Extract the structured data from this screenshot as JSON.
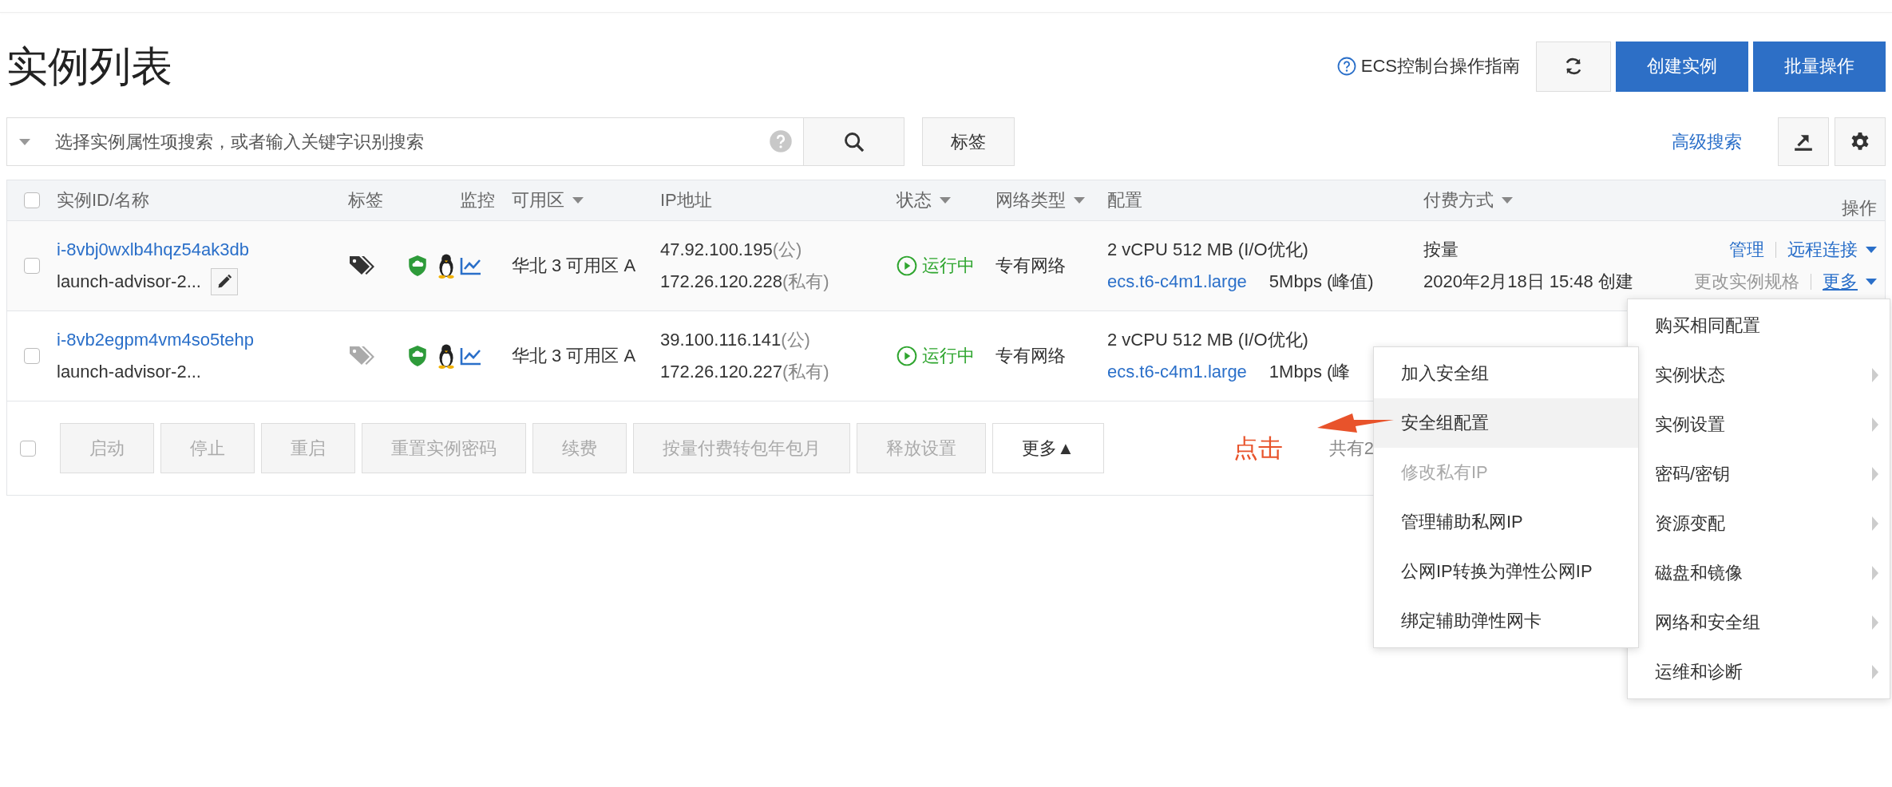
{
  "page_title": "实例列表",
  "header_actions": {
    "guide_link": "ECS控制台操作指南",
    "buttons": [
      {
        "label": "创建实例"
      },
      {
        "label": "批量操作"
      }
    ]
  },
  "search": {
    "placeholder": "选择实例属性项搜索，或者输入关键字识别搜索"
  },
  "tag_button": "标签",
  "advanced_search": "高级搜索",
  "table": {
    "header_checked": false,
    "columns": [
      {
        "label": "实例ID/名称",
        "sortable": false
      },
      {
        "label": "标签",
        "sortable": false
      },
      {
        "label": "监控",
        "sortable": false
      },
      {
        "label": "可用区",
        "sortable": true
      },
      {
        "label": "IP地址",
        "sortable": false
      },
      {
        "label": "状态",
        "sortable": true
      },
      {
        "label": "网络类型",
        "sortable": true
      },
      {
        "label": "配置",
        "sortable": false
      },
      {
        "label": "付费方式",
        "sortable": true
      },
      {
        "label": "操作",
        "sortable": false
      }
    ],
    "rows": [
      {
        "checked": false,
        "id": "i-8vbj0wxlb4hqz54ak3db",
        "name": "launch-advisor-2...",
        "name_editable": true,
        "tagged": true,
        "zone": "华北 3 可用区 A",
        "public_ip": "47.92.100.195",
        "public_suffix": "(公)",
        "private_ip": "172.26.120.228",
        "private_suffix": "(私有)",
        "status": "运行中",
        "network": "专有网络",
        "spec": "2 vCPU 512 MB (I/O优化)",
        "instance_type": "ecs.t6-c4m1.large",
        "bandwidth": "5Mbps (峰值)",
        "billing": "按量",
        "created": "2020年2月18日 15:48 创建",
        "actions": [
          [
            {
              "label": "管理",
              "kind": "link"
            },
            {
              "label": "远程连接",
              "kind": "dropdown",
              "expanded": false
            }
          ],
          [
            {
              "label": "更改实例规格",
              "kind": "disabled"
            },
            {
              "label": "更多",
              "kind": "dropdown",
              "expanded": true
            }
          ]
        ]
      },
      {
        "checked": false,
        "id": "i-8vb2egpm4vm4so5tehp",
        "name": "launch-advisor-2...",
        "name_editable": false,
        "tagged": false,
        "zone": "华北 3 可用区 A",
        "public_ip": "39.100.116.141",
        "public_suffix": "(公)",
        "private_ip": "172.26.120.227",
        "private_suffix": "(私有)",
        "status": "运行中",
        "network": "专有网络",
        "spec": "2 vCPU 512 MB (I/O优化)",
        "instance_type": "ecs.t6-c4m1.large",
        "bandwidth": "1Mbps (峰"
      }
    ]
  },
  "footer": {
    "checked": false,
    "buttons": [
      {
        "label": "启动",
        "disabled": true
      },
      {
        "label": "停止",
        "disabled": true
      },
      {
        "label": "重启",
        "disabled": true
      },
      {
        "label": "重置实例密码",
        "disabled": true
      },
      {
        "label": "续费",
        "disabled": true
      },
      {
        "label": "按量付费转包年包月",
        "disabled": true
      },
      {
        "label": "释放设置",
        "disabled": true
      },
      {
        "label": "更多▲",
        "disabled": false
      }
    ],
    "total": "共有2"
  },
  "annotation": {
    "text": "点击"
  },
  "context_menu": {
    "items": [
      {
        "label": "购买相同配置",
        "has_submenu": false
      },
      {
        "label": "实例状态",
        "has_submenu": true
      },
      {
        "label": "实例设置",
        "has_submenu": true
      },
      {
        "label": "密码/密钥",
        "has_submenu": true
      },
      {
        "label": "资源变配",
        "has_submenu": true
      },
      {
        "label": "磁盘和镜像",
        "has_submenu": true
      },
      {
        "label": "网络和安全组",
        "has_submenu": true
      },
      {
        "label": "运维和诊断",
        "has_submenu": true
      }
    ]
  },
  "submenu": {
    "items": [
      {
        "label": "加入安全组",
        "disabled": false,
        "selected": false
      },
      {
        "label": "安全组配置",
        "disabled": false,
        "selected": true
      },
      {
        "label": "修改私有IP",
        "disabled": true,
        "selected": false
      },
      {
        "label": "管理辅助私网IP",
        "disabled": false,
        "selected": false
      },
      {
        "label": "公网IP转换为弹性公网IP",
        "disabled": false,
        "selected": false
      },
      {
        "label": "绑定辅助弹性网卡",
        "disabled": false,
        "selected": false
      }
    ]
  }
}
